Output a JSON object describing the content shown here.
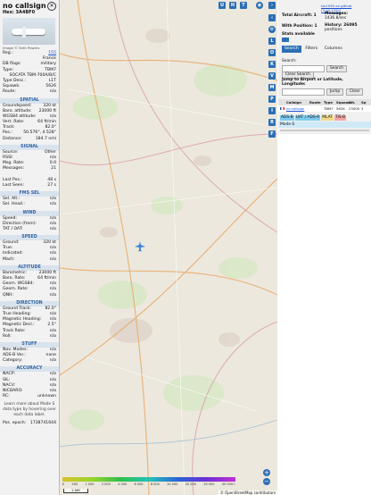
{
  "panel": {
    "title": "no callsign",
    "hex_line": "Hex: 3A4BF0",
    "photo_credit": "Image © Seth Powers",
    "rows_top": [
      {
        "label": "Reg.:",
        "value": "155",
        "link": true
      },
      {
        "label": "",
        "value": "France"
      },
      {
        "label": "DB flags:",
        "value": "military"
      },
      {
        "label": "Type:",
        "value": "TBM7"
      },
      {
        "label": "",
        "value": "SOCATA TBM-700A/B/C"
      },
      {
        "label": "Type Desc.:",
        "value": "L1T"
      },
      {
        "label": "Squawk:",
        "value": "5626"
      },
      {
        "label": "Route:",
        "value": "n/a"
      }
    ],
    "sections": [
      {
        "title": "SPATIAL",
        "rows": [
          {
            "label": "Groundspeed:",
            "value": "320 kt"
          },
          {
            "label": "Baro. altitude:",
            "value": "23000 ft"
          },
          {
            "label": "WGS84 altitude:",
            "value": "n/a"
          },
          {
            "label": "Vert. Rate:",
            "value": "64 ft/min"
          },
          {
            "label": "Track:",
            "value": "82.0°"
          },
          {
            "label": "Pos.:",
            "value": "50.576°, 4.528°"
          },
          {
            "label": "Distance:",
            "value": "184.7 nmi"
          }
        ]
      },
      {
        "title": "SIGNAL",
        "rows": [
          {
            "label": "Source:",
            "value": "Other"
          },
          {
            "label": "RSSI:",
            "value": "n/a"
          },
          {
            "label": "Msg. Rate:",
            "value": "0.0"
          },
          {
            "label": "Messages:",
            "value": "21"
          },
          {
            "label": "",
            "value": ""
          },
          {
            "label": "Last Pos.:",
            "value": "48 s"
          },
          {
            "label": "Last Seen:",
            "value": "27 s"
          }
        ]
      },
      {
        "title": "FMS SEL",
        "rows": [
          {
            "label": "Sel. Alt.:",
            "value": "n/a"
          },
          {
            "label": "Sel. Head.:",
            "value": "n/a"
          }
        ]
      },
      {
        "title": "WIND",
        "rows": [
          {
            "label": "Speed:",
            "value": "n/a"
          },
          {
            "label": "Direction (from):",
            "value": "n/a"
          },
          {
            "label": "TAT / OAT:",
            "value": "n/a"
          }
        ]
      },
      {
        "title": "SPEED",
        "rows": [
          {
            "label": "Ground:",
            "value": "320 kt"
          },
          {
            "label": "True:",
            "value": "n/a"
          },
          {
            "label": "Indicated:",
            "value": "n/a"
          },
          {
            "label": "Mach:",
            "value": "n/a"
          }
        ]
      },
      {
        "title": "ALTITUDE",
        "rows": [
          {
            "label": "Barometric:",
            "value": "23000 ft"
          },
          {
            "label": "Baro. Rate:",
            "value": "64 ft/min"
          },
          {
            "label": "Geom. WGS84:",
            "value": "n/a"
          },
          {
            "label": "Geom. Rate:",
            "value": "n/a"
          },
          {
            "label": "QNH:",
            "value": "n/a"
          }
        ]
      },
      {
        "title": "DIRECTION",
        "rows": [
          {
            "label": "Ground Track:",
            "value": "82.0°"
          },
          {
            "label": "True Heading:",
            "value": "n/a"
          },
          {
            "label": "Magnetic Heading:",
            "value": "n/a"
          },
          {
            "label": "Magnetic Decl.:",
            "value": "2.5°"
          },
          {
            "label": "Track Rate:",
            "value": "n/a"
          },
          {
            "label": "Roll:",
            "value": "n/a"
          }
        ]
      },
      {
        "title": "STUFF",
        "rows": [
          {
            "label": "Nav. Modes:",
            "value": "n/a"
          },
          {
            "label": "ADS-B Ver.:",
            "value": "none"
          },
          {
            "label": "Category:",
            "value": "n/a"
          }
        ]
      },
      {
        "title": "ACCURACY",
        "rows": [
          {
            "label": "NACP:",
            "value": "n/a"
          },
          {
            "label": "SIL:",
            "value": "n/a"
          },
          {
            "label": "NACV:",
            "value": "n/a"
          },
          {
            "label": "NICBARO:",
            "value": "n/a"
          },
          {
            "label": "RC:",
            "value": "unknown"
          }
        ]
      }
    ],
    "note": "Learn more about Mode S data type by hovering over each data label.",
    "pos_epoch_label": "Pos. epoch:",
    "pos_epoch_value": "1738741644"
  },
  "map": {
    "top_buttons": [
      "U",
      "H",
      "T"
    ],
    "side_buttons": [
      "L",
      "O",
      "K",
      "V",
      "M",
      "P",
      "I",
      "R",
      "F"
    ],
    "colorbar_labels": [
      "0",
      "500",
      "1 000",
      "2 000",
      "4 000",
      "6 000",
      "8 000",
      "10 000",
      "20 000",
      "30 000",
      "40 000+"
    ],
    "scale_label": "2 NM",
    "zoom_in": "+",
    "zoom_out": "−",
    "attribution": "© OpenStreetMap contributors",
    "plane_color": "#3d86d6"
  },
  "right": {
    "version_link": "tar1090 on github (3.14.1702)",
    "stats": [
      {
        "label": "Total Aircraft:",
        "value": "1"
      },
      {
        "label": "With Position:",
        "value": "1"
      },
      {
        "label": "Stats available",
        "value": ""
      }
    ],
    "stats_right": [
      {
        "label": "Messages:",
        "value": "1436.8/sec"
      },
      {
        "label": "History: 26095",
        "value": "positions"
      }
    ],
    "tabs": [
      "Search",
      "Filters",
      "Columns"
    ],
    "search_label": "Search:",
    "search_button": "Search",
    "clear_search": "Clear Search",
    "jump_label": "Jump to Airport or Latitude, Longitude:",
    "jump_button": "Jump",
    "clear_button": "Clear",
    "table_headers": [
      "",
      "Callsign",
      "Route",
      "Type",
      "Squawk",
      "Alt. (ft)",
      "Sp"
    ],
    "table_row": {
      "callsign": "no callsign",
      "type": "TBM7",
      "squawk": "5626",
      "alt": "23000",
      "sp": "3"
    },
    "source_chips": [
      {
        "label": "ADS-B",
        "color": "#7ecbef"
      },
      {
        "label": "UAT / ADS-R",
        "color": "#7ecbef"
      },
      {
        "label": "MLAT",
        "color": "#f0d98a"
      },
      {
        "label": "TIS-B",
        "color": "#f4a6a6"
      }
    ],
    "modes_label": "Mode-S"
  }
}
